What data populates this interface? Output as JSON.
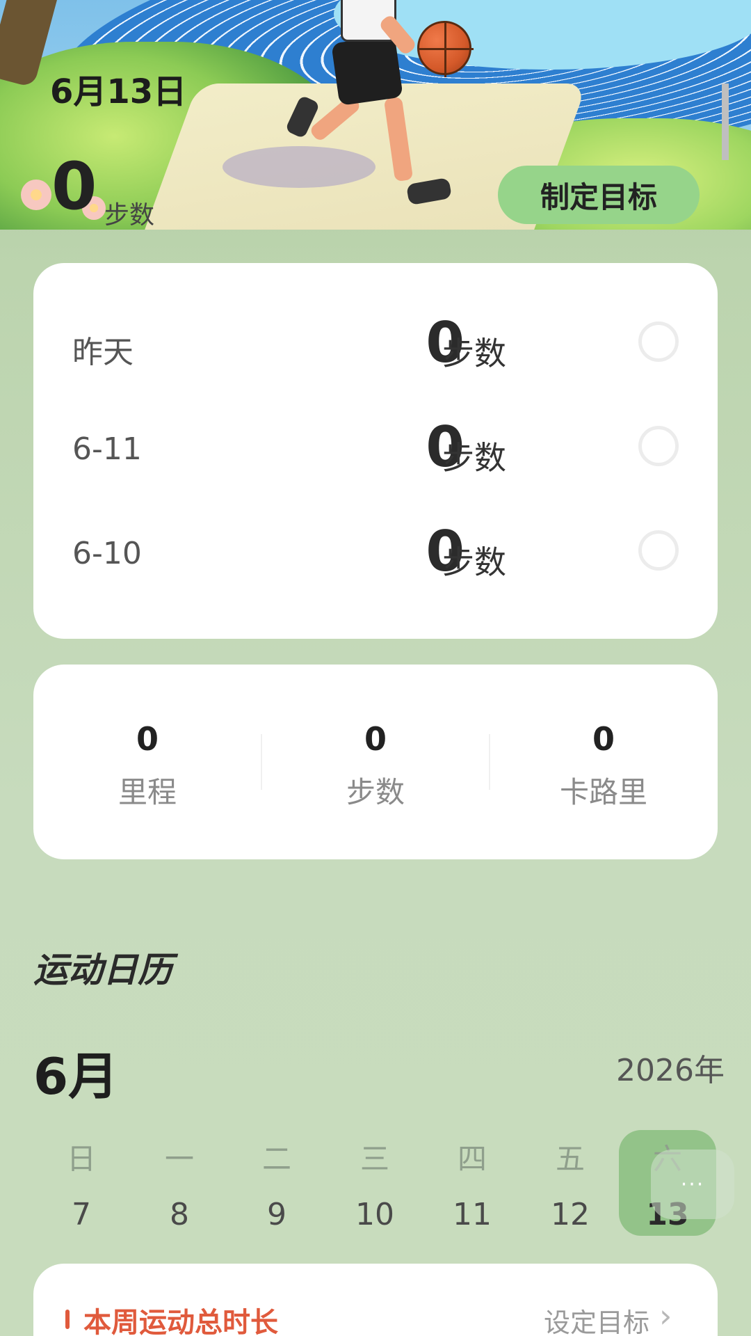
{
  "hero": {
    "date": "6月13日",
    "steps_value": "0",
    "steps_unit": "步数",
    "goal_button": "制定目标"
  },
  "history": [
    {
      "day": "昨天",
      "value": "0",
      "unit": "步数"
    },
    {
      "day": "6-11",
      "value": "0",
      "unit": "步数"
    },
    {
      "day": "6-10",
      "value": "0",
      "unit": "步数"
    }
  ],
  "summary": [
    {
      "value": "0",
      "label": "里程"
    },
    {
      "value": "0",
      "label": "步数"
    },
    {
      "value": "0",
      "label": "卡路里"
    }
  ],
  "calendar": {
    "title": "运动日历",
    "month": "6月",
    "year": "2026年",
    "weekdays": [
      "日",
      "一",
      "二",
      "三",
      "四",
      "五",
      "六"
    ],
    "dates": [
      "7",
      "8",
      "9",
      "10",
      "11",
      "12",
      "13"
    ],
    "today_index": 6,
    "more_label": "···"
  },
  "week_card": {
    "title": "本周运动总时长",
    "link": "设定目标",
    "chevron": "›"
  },
  "colors": {
    "accent_green": "#96d48a",
    "today_highlight": "#93c389",
    "week_title_red": "#e05a3c"
  }
}
